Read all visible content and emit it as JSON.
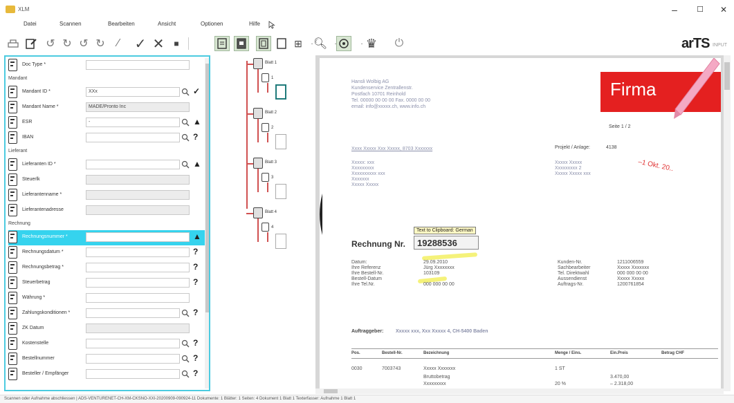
{
  "window": {
    "title": "XLM",
    "minimize": "–",
    "maximize": "☐",
    "close": "✕"
  },
  "menu": [
    "Datei",
    "Scannen",
    "Bearbeiten",
    "Ansicht",
    "Optionen",
    "Hilfe"
  ],
  "brand": {
    "name": "arTS",
    "sub": "INPUT"
  },
  "form": {
    "rows": [
      {
        "type": "field",
        "label": "Doc Type *",
        "value": "",
        "readonly": false,
        "search": false,
        "state": ""
      },
      {
        "type": "section",
        "label": "Mandant"
      },
      {
        "type": "field",
        "label": "Mandant ID *",
        "value": "XXx",
        "readonly": false,
        "search": true,
        "state": "✓"
      },
      {
        "type": "field",
        "label": "Mandant Name *",
        "value": "MADE/Pronto Inc",
        "readonly": true,
        "search": false,
        "state": ""
      },
      {
        "type": "field",
        "label": "ESR",
        "value": "-",
        "readonly": false,
        "search": true,
        "state": "▲"
      },
      {
        "type": "field",
        "label": "IBAN",
        "value": "",
        "readonly": false,
        "search": true,
        "state": "?"
      },
      {
        "type": "section",
        "label": "Lieferant"
      },
      {
        "type": "field",
        "label": "Lieferanten ID *",
        "value": "",
        "readonly": false,
        "search": true,
        "state": "▲"
      },
      {
        "type": "field",
        "label": "Steuerlk",
        "value": "",
        "readonly": true,
        "search": false,
        "state": ""
      },
      {
        "type": "field",
        "label": "Lieferantenname *",
        "value": "",
        "readonly": true,
        "search": false,
        "state": ""
      },
      {
        "type": "field",
        "label": "Lieferantenadresse",
        "value": "",
        "readonly": true,
        "search": false,
        "state": ""
      },
      {
        "type": "section",
        "label": "Rechnung"
      },
      {
        "type": "field",
        "label": "Rechnungsnummer *",
        "value": "",
        "readonly": false,
        "search": false,
        "state": "▲",
        "active": true
      },
      {
        "type": "field",
        "label": "Rechnungsdatum *",
        "value": "",
        "readonly": false,
        "search": false,
        "state": "?"
      },
      {
        "type": "field",
        "label": "Rechnungsbetrag *",
        "value": "",
        "readonly": false,
        "search": false,
        "state": "?"
      },
      {
        "type": "field",
        "label": "Steuerbetrag",
        "value": "",
        "readonly": false,
        "search": false,
        "state": "?"
      },
      {
        "type": "field",
        "label": "Währung *",
        "value": "",
        "readonly": false,
        "search": false,
        "state": ""
      },
      {
        "type": "field",
        "label": "Zahlungskonditionen *",
        "value": "",
        "readonly": false,
        "search": true,
        "state": "?"
      },
      {
        "type": "field",
        "label": "ZK Datum",
        "value": "",
        "readonly": true,
        "search": false,
        "state": ""
      },
      {
        "type": "field",
        "label": "Kostenstelle",
        "value": "",
        "readonly": false,
        "search": true,
        "state": "?"
      },
      {
        "type": "field",
        "label": "Bestellnummer",
        "value": "",
        "readonly": false,
        "search": true,
        "state": "?"
      },
      {
        "type": "field",
        "label": "Besteller / Empfänger",
        "value": "",
        "readonly": false,
        "search": true,
        "state": "?"
      }
    ]
  },
  "tree": {
    "pages": [
      {
        "label": "Blatt 1",
        "sub": "1"
      },
      {
        "label": "Blatt 2",
        "sub": "2"
      },
      {
        "label": "Blatt 3",
        "sub": "3"
      },
      {
        "label": "Blatt 4",
        "sub": "4"
      }
    ]
  },
  "document": {
    "sender": [
      "Hansli Wolbig AG",
      "Kundenservice Zentrallenstr.",
      "Postfach 10701 Reinhold",
      "Tel. 00000 00 00 00 Fax. 0000 00 00",
      "email: info@xxxxx.ch, www.info.ch"
    ],
    "firma": "Firma",
    "page_no": "Seite 1 / 2",
    "recipient_line": "Xxxx Xxxxx Xxx Xxxxx, 8703 Xxxxxxx",
    "projekt_label": "Projekt / Anlage:",
    "projekt_value": "4138",
    "stamp": "–1 Okt. 20..",
    "address_left": [
      "Xxxxx: xxx",
      "Xxxxxxxxx",
      "Xxxxxxxxxx xxx",
      "Xxxxxxx",
      "Xxxxx Xxxxx"
    ],
    "address_right": [
      "Xxxxx Xxxxx",
      "Xxxxxxxxx 2",
      "Xxxxx Xxxxx xxx"
    ],
    "tooltip": "Text to Clipboard: German",
    "invoice_label": "Rechnung Nr.",
    "invoice_number": "19288536",
    "meta_labels": [
      "Datum:",
      "Ihre Referenz",
      "Ihre Bestell-Nr.",
      "Bestell-Datum",
      "Ihre Tel.Nr."
    ],
    "meta_values": [
      "29.09.2010",
      "Jürg Xxxxxxxx",
      "103109",
      "",
      "000 000 00 00"
    ],
    "kunden_labels": [
      "Kunden-Nr.",
      "Sachbearbeiter",
      "Tel. Direktwahl",
      "Aussendienst",
      "Auftrags-Nr."
    ],
    "kunden_values": [
      "1211006559",
      "Xxxxx Xxxxxxx",
      "000 000 00 00",
      "Xxxxx Xxxxx",
      "1200761854"
    ],
    "auftraggeber_label": "Auftraggeber:",
    "auftraggeber_value": "Xxxxx xxx, Xxx Xxxxx 4, CH-5400 Baden",
    "table_headers": [
      "Pos.",
      "Bestell-Nr.",
      "Bezeichnung",
      "Menge / Eins.",
      "Ein.Preis",
      "Betrag CHF"
    ],
    "table_row": [
      "0030",
      "7003743",
      "Xxxxx Xxxxxxx",
      "1 ST",
      "",
      ""
    ],
    "table_row2": [
      "",
      "",
      "Bruttobetrag",
      "",
      "3.470,00",
      ""
    ],
    "table_row3": [
      "",
      "",
      "Xxxxxxxxx",
      "20 %",
      "– 2.318,00",
      ""
    ]
  },
  "status": "Scannen oder Aufnahme abschliessen   |   ADS-VENTURENET-CH-XM-CKSNO-XXI-20200909-090924-11  Dokumente: 1 Blätter: 1 Seiten: 4   Dokument 1 Blatt 1   Texterfasser: Aufnahme 1 Blatt 1"
}
